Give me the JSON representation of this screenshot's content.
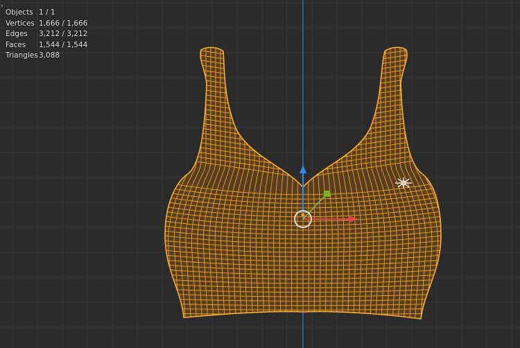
{
  "stats": [
    {
      "label": "Objects",
      "value": "1 / 1"
    },
    {
      "label": "Vertices",
      "value": "1,666 / 1,666"
    },
    {
      "label": "Edges",
      "value": "3,212 / 3,212"
    },
    {
      "label": "Faces",
      "value": "1,544 / 1,544"
    },
    {
      "label": "Triangles",
      "value": "3,088"
    }
  ],
  "icons": {
    "collapse": "chevron-right-icon"
  },
  "colors": {
    "background": "#2b2b2b",
    "wire": "#f5a21c",
    "face": "#5c4020",
    "x_axis": "#e8424f",
    "z_axis": "#2d8ceb"
  }
}
